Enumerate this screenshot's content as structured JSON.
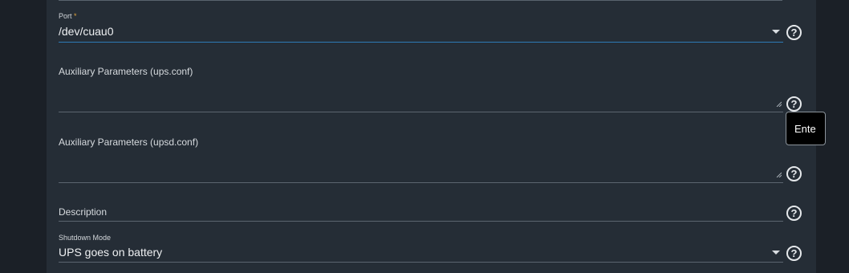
{
  "fields": {
    "port": {
      "label": "Port",
      "required_mark": "*",
      "value": "/dev/cuau0",
      "help_icon": "help-circle-icon"
    },
    "aux_ups": {
      "label": "Auxiliary Parameters (ups.conf)",
      "value": "",
      "help_icon": "help-circle-icon"
    },
    "aux_upsd": {
      "label": "Auxiliary Parameters (upsd.conf)",
      "value": "",
      "help_icon": "help-circle-icon"
    },
    "description": {
      "label": "Description",
      "value": "",
      "help_icon": "help-circle-icon"
    },
    "shutdown_mode": {
      "label": "Shutdown Mode",
      "value": "UPS goes on battery",
      "help_icon": "help-circle-icon"
    }
  },
  "tooltip": {
    "text": "Ente"
  },
  "help_glyph": "?",
  "colors": {
    "panel": "#252d36",
    "background": "#1b2026",
    "focus_underline": "#2e7bb7",
    "required": "#e2a43c"
  }
}
